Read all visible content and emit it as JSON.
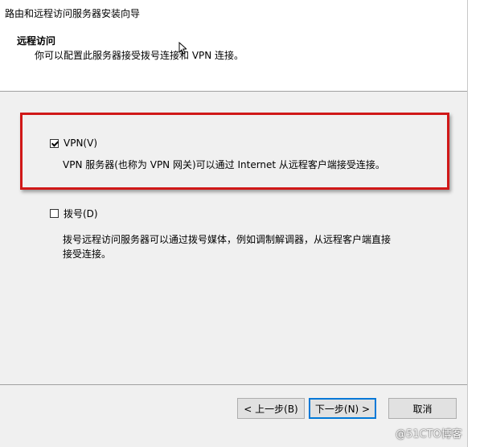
{
  "window": {
    "title": "路由和远程访问服务器安装向导"
  },
  "header": {
    "title": "远程访问",
    "subtitle": "你可以配置此服务器接受拨号连接和 VPN 连接。"
  },
  "options": [
    {
      "label": "VPN(V)",
      "checked": true,
      "description": "VPN 服务器(也称为 VPN 网关)可以通过 Internet 从远程客户端接受连接。"
    },
    {
      "label": "拨号(D)",
      "checked": false,
      "description_line1": "拨号远程访问服务器可以通过拨号媒体，例如调制解调器，从远程客户端直接",
      "description_line2": "接受连接。"
    }
  ],
  "buttons": {
    "back": "< 上一步(B)",
    "next": "下一步(N) >",
    "cancel": "取消"
  },
  "watermark": "@51CTO博客",
  "colors": {
    "highlight_border": "#d01818",
    "default_button_border": "#0078d7"
  }
}
